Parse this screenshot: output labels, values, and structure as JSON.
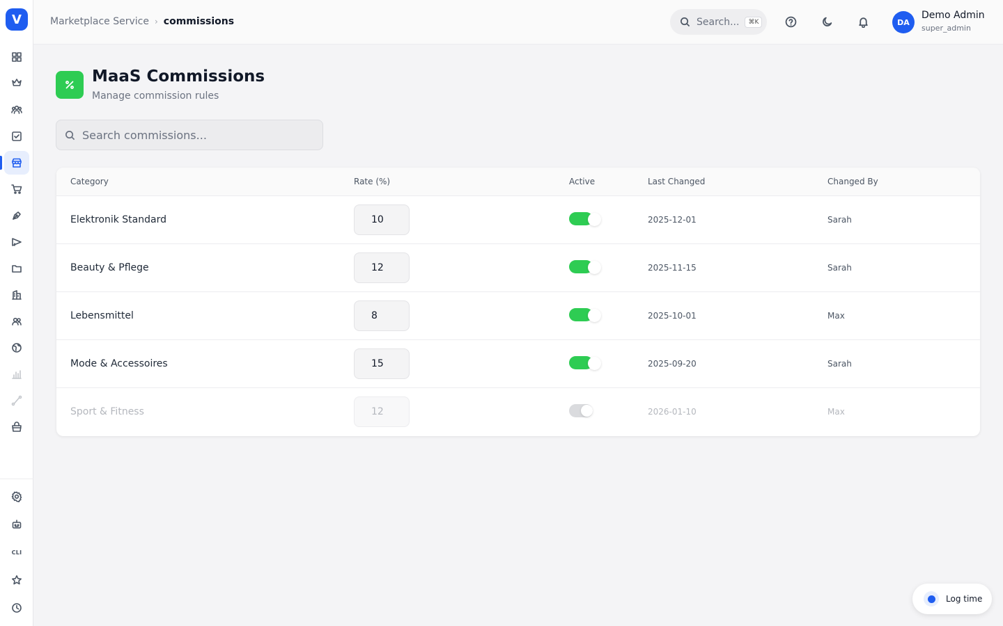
{
  "app": {
    "logo_letter": "V"
  },
  "breadcrumb": {
    "root": "Marketplace Service",
    "current": "commissions"
  },
  "topbar": {
    "search_placeholder": "Search...",
    "shortcut": "⌘K",
    "user": {
      "initials": "DA",
      "name": "Demo Admin",
      "role": "super_admin"
    }
  },
  "sidebar": {
    "items": [
      {
        "icon": "dashboard-icon"
      },
      {
        "icon": "crown-icon"
      },
      {
        "icon": "users-icon"
      },
      {
        "icon": "task-check-icon"
      },
      {
        "icon": "store-icon",
        "active": true
      },
      {
        "icon": "cart-icon"
      },
      {
        "icon": "pen-tool-icon"
      },
      {
        "icon": "megaphone-icon"
      },
      {
        "icon": "folder-icon"
      },
      {
        "icon": "building-icon"
      },
      {
        "icon": "team-icon"
      },
      {
        "icon": "globe-icon"
      },
      {
        "icon": "bar-chart-icon"
      },
      {
        "icon": "route-icon"
      },
      {
        "icon": "basket-icon"
      }
    ],
    "bottom_items": [
      {
        "icon": "settings-icon"
      },
      {
        "icon": "bot-icon"
      },
      {
        "icon": "cli-icon",
        "label": "CLI"
      },
      {
        "icon": "star-icon"
      },
      {
        "icon": "clock-icon"
      }
    ]
  },
  "page": {
    "title": "MaaS Commissions",
    "subtitle": "Manage commission rules",
    "icon_color": "#2ecc53",
    "search_placeholder": "Search commissions..."
  },
  "table": {
    "columns": [
      "Category",
      "Rate (%)",
      "Active",
      "Last Changed",
      "Changed By"
    ],
    "rows": [
      {
        "category": "Elektronik Standard",
        "rate": "10",
        "active": true,
        "last_changed": "2025-12-01",
        "changed_by": "Sarah"
      },
      {
        "category": "Beauty & Pflege",
        "rate": "12",
        "active": true,
        "last_changed": "2025-11-15",
        "changed_by": "Sarah"
      },
      {
        "category": "Lebensmittel",
        "rate": "8",
        "active": true,
        "last_changed": "2025-10-01",
        "changed_by": "Max"
      },
      {
        "category": "Mode & Accessoires",
        "rate": "15",
        "active": true,
        "last_changed": "2025-09-20",
        "changed_by": "Sarah"
      },
      {
        "category": "Sport & Fitness",
        "rate": "12",
        "active": false,
        "last_changed": "2026-01-10",
        "changed_by": "Max"
      }
    ]
  },
  "log_time": {
    "label": "Log time"
  },
  "colors": {
    "accent": "#1f5df0",
    "active_toggle": "#2ecc53",
    "inactive_toggle": "#dadbde"
  }
}
